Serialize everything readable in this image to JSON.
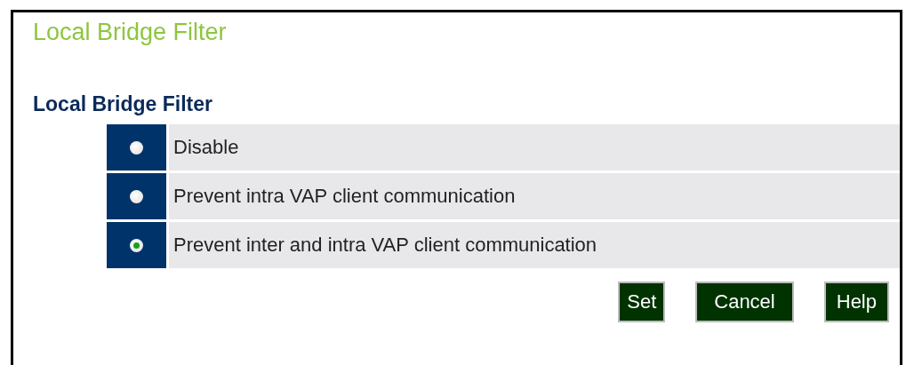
{
  "page_title": "Local Bridge Filter",
  "section_title": "Local Bridge Filter",
  "options": [
    {
      "label": "Disable",
      "selected": false
    },
    {
      "label": "Prevent intra VAP client communication",
      "selected": false
    },
    {
      "label": "Prevent inter and intra VAP client communication",
      "selected": true
    }
  ],
  "buttons": [
    "Set",
    "Cancel",
    "Help"
  ]
}
